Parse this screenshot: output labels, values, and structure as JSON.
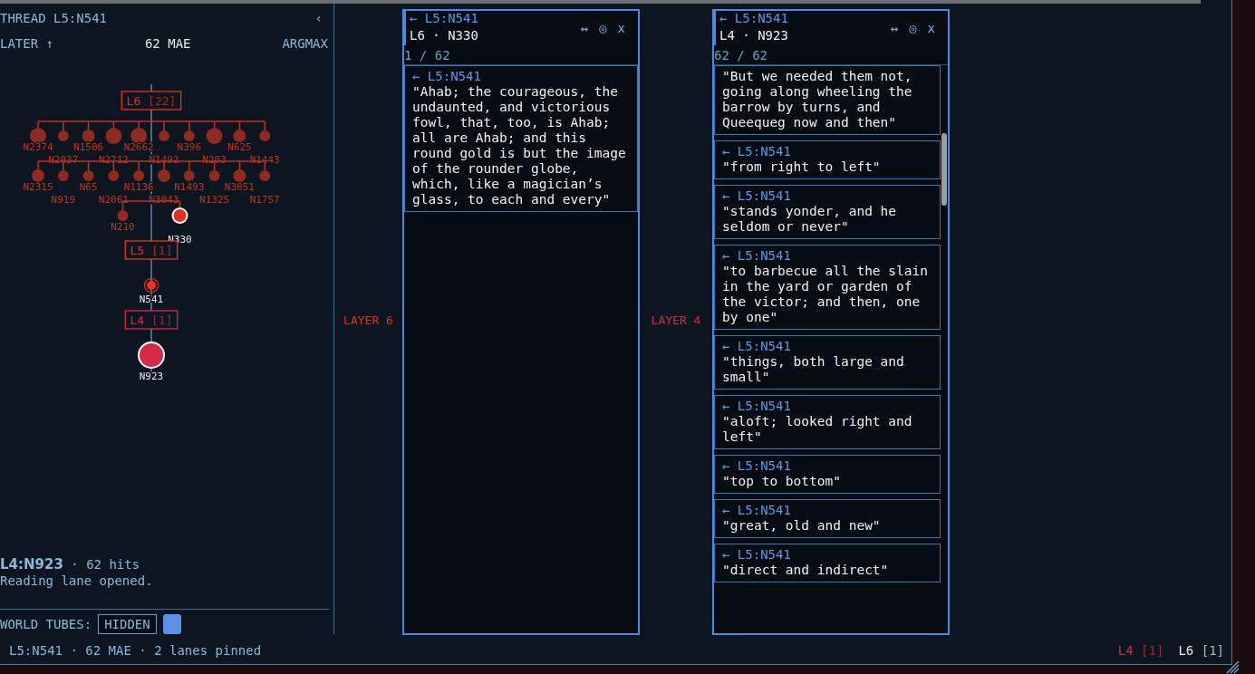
{
  "thread_panel": {
    "title": "THREAD L5:N541",
    "collapse": "‹",
    "sort": "LATER ↑",
    "total": "62 MAE",
    "mode": "ARGMAX",
    "layers": [
      {
        "label": "L6",
        "count": "[22]",
        "color": "#e0301e",
        "nodes": [
          {
            "label": "N2374",
            "kind": "large",
            "selected": false
          },
          {
            "label": "N2037",
            "kind": "small",
            "selected": false
          },
          {
            "label": "N1506",
            "kind": "medium",
            "selected": false
          },
          {
            "label": "N2712",
            "kind": "large",
            "selected": false
          },
          {
            "label": "N2662",
            "kind": "large",
            "selected": false
          },
          {
            "label": "N1492",
            "kind": "small",
            "selected": false
          },
          {
            "label": "N396",
            "kind": "small",
            "selected": false
          },
          {
            "label": "N203",
            "kind": "large",
            "selected": false
          },
          {
            "label": "N625",
            "kind": "medium",
            "selected": false
          },
          {
            "label": "N1443",
            "kind": "small",
            "selected": false
          },
          {
            "label": "N2315",
            "kind": "medium",
            "selected": false
          },
          {
            "label": "N919",
            "kind": "small",
            "selected": false
          },
          {
            "label": "N65",
            "kind": "small",
            "selected": false
          },
          {
            "label": "N2061",
            "kind": "small",
            "selected": false
          },
          {
            "label": "N1136",
            "kind": "small",
            "selected": false
          },
          {
            "label": "N3043",
            "kind": "medium",
            "selected": false
          },
          {
            "label": "N1493",
            "kind": "small",
            "selected": false
          },
          {
            "label": "N1325",
            "kind": "small",
            "selected": false
          },
          {
            "label": "N3051",
            "kind": "medium",
            "selected": false
          },
          {
            "label": "N1757",
            "kind": "small",
            "selected": false
          },
          {
            "label": "N210",
            "kind": "small",
            "selected": false
          },
          {
            "label": "N330",
            "kind": "medium",
            "selected": true
          }
        ]
      },
      {
        "label": "L5",
        "count": "[1]",
        "color": "#ee321e",
        "nodes": [
          {
            "label": "N541",
            "kind": "ringed",
            "selected": false
          }
        ]
      },
      {
        "label": "L4",
        "count": "[1]",
        "color": "#d42a48",
        "nodes": [
          {
            "label": "N923",
            "kind": "huge",
            "selected": true
          }
        ]
      }
    ],
    "selection": {
      "node": "L4:N923",
      "hits": "· 62 hits",
      "message": "Reading lane opened."
    },
    "world_tubes": {
      "label": "WORLD TUBES:",
      "value": "HIDDEN"
    }
  },
  "lanes": [
    {
      "layer_label": "LAYER 6",
      "color": "#e0301e",
      "source": "← L5:N541",
      "title": "L6 · N330",
      "controls": [
        "↔",
        "◎",
        "x"
      ],
      "count": "1 / 62",
      "cards": [
        {
          "source": "← L5:N541",
          "quote": "\"Ahab; the courageous, the undaunted, and victorious fowl, that, too, is Ahab; all are Ahab; and this round gold is but the image of the rounder globe, which, like a magician’s glass, to each and every\""
        }
      ]
    },
    {
      "layer_label": "LAYER 4",
      "color": "#d42a48",
      "source": "← L5:N541",
      "title": "L4 · N923",
      "controls": [
        "↔",
        "◎",
        "x"
      ],
      "count": "62 / 62",
      "cards": [
        {
          "quote": "\"But we needed them not, going along wheeling the barrow by turns, and Queequeg now and then\""
        },
        {
          "source": "← L5:N541",
          "quote": "\"from right to left\""
        },
        {
          "source": "← L5:N541",
          "quote": "\"stands yonder, and he seldom or never\""
        },
        {
          "source": "← L5:N541",
          "quote": "\"to barbecue all the slain in the yard or garden of the victor; and then, one by one\""
        },
        {
          "source": "← L5:N541",
          "quote": "\"things, both large and small\""
        },
        {
          "source": "← L5:N541",
          "quote": "\"aloft; looked right and left\""
        },
        {
          "source": "← L5:N541",
          "quote": "\"top to bottom\""
        },
        {
          "source": "← L5:N541",
          "quote": "\"great, old and new\""
        },
        {
          "source": "← L5:N541",
          "quote": "\"direct and indirect\""
        }
      ]
    }
  ],
  "status_bar": {
    "summary": "L5:N541 · 62 MAE · 2 lanes pinned",
    "layers": [
      {
        "label": "L4",
        "count": "[1]",
        "color": "#d42a48"
      },
      {
        "label": "L6",
        "count": "[1]",
        "color": "#e8e8e8"
      }
    ]
  }
}
